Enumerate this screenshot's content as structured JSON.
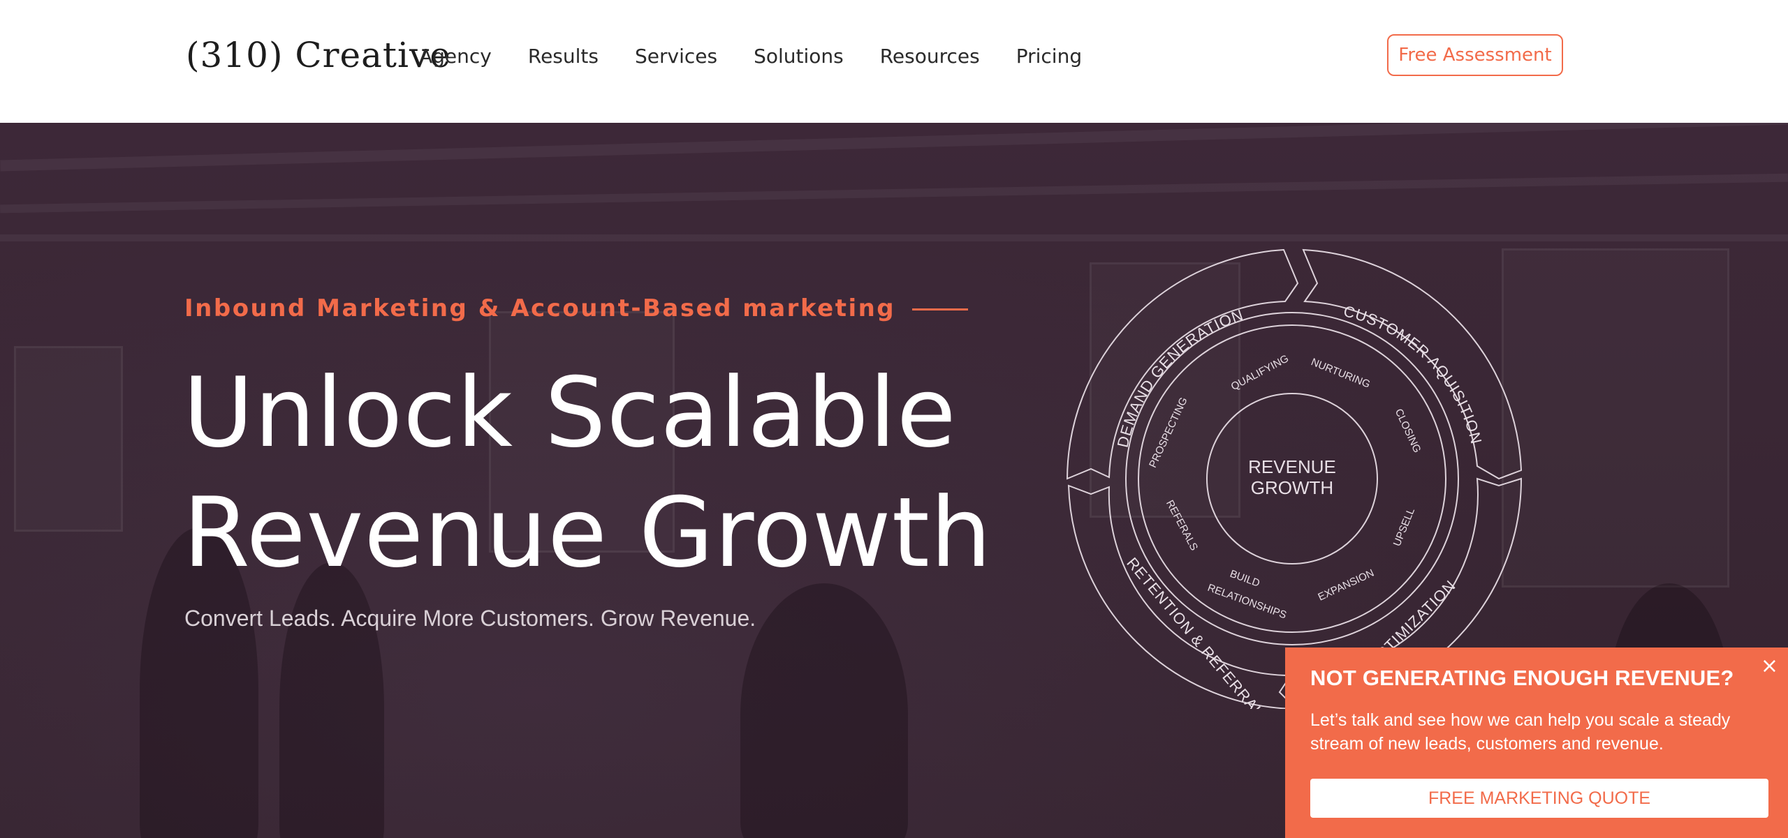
{
  "header": {
    "logo_text": "(310) Creative",
    "nav": [
      "Agency",
      "Results",
      "Services",
      "Solutions",
      "Resources",
      "Pricing"
    ],
    "cta_label": "Free Assessment"
  },
  "hero": {
    "eyebrow": "Inbound Marketing & Account-Based marketing",
    "headline_line1": "Unlock Scalable",
    "headline_line2": "Revenue Growth",
    "subhead": "Convert Leads. Acquire More Customers. Grow Revenue."
  },
  "diagram": {
    "center_line1": "REVENUE",
    "center_line2": "GROWTH",
    "outer": {
      "top_left": "DEMAND GENERATION",
      "top_right": "CUSTOMER AQUISITION",
      "bottom_left": "RETENTION & REFERRAL",
      "bottom_right": "OPTIMIZATION"
    },
    "inner": {
      "qualifying": "QUALIFYING",
      "nurturing": "NURTURING",
      "prospecting": "PROSPECTING",
      "closing": "CLOSING",
      "referrals": "REFERALS",
      "upsell": "UPSELL",
      "build1": "BUILD",
      "build2": "RELATIONSHIPS",
      "expansion": "EXPANSION"
    }
  },
  "popup": {
    "title": "NOT GENERATING ENOUGH REVENUE?",
    "text": "Let’s talk and see how we can help you scale a steady stream of new leads, customers and revenue.",
    "button": "FREE MARKETING QUOTE",
    "close": "×"
  }
}
